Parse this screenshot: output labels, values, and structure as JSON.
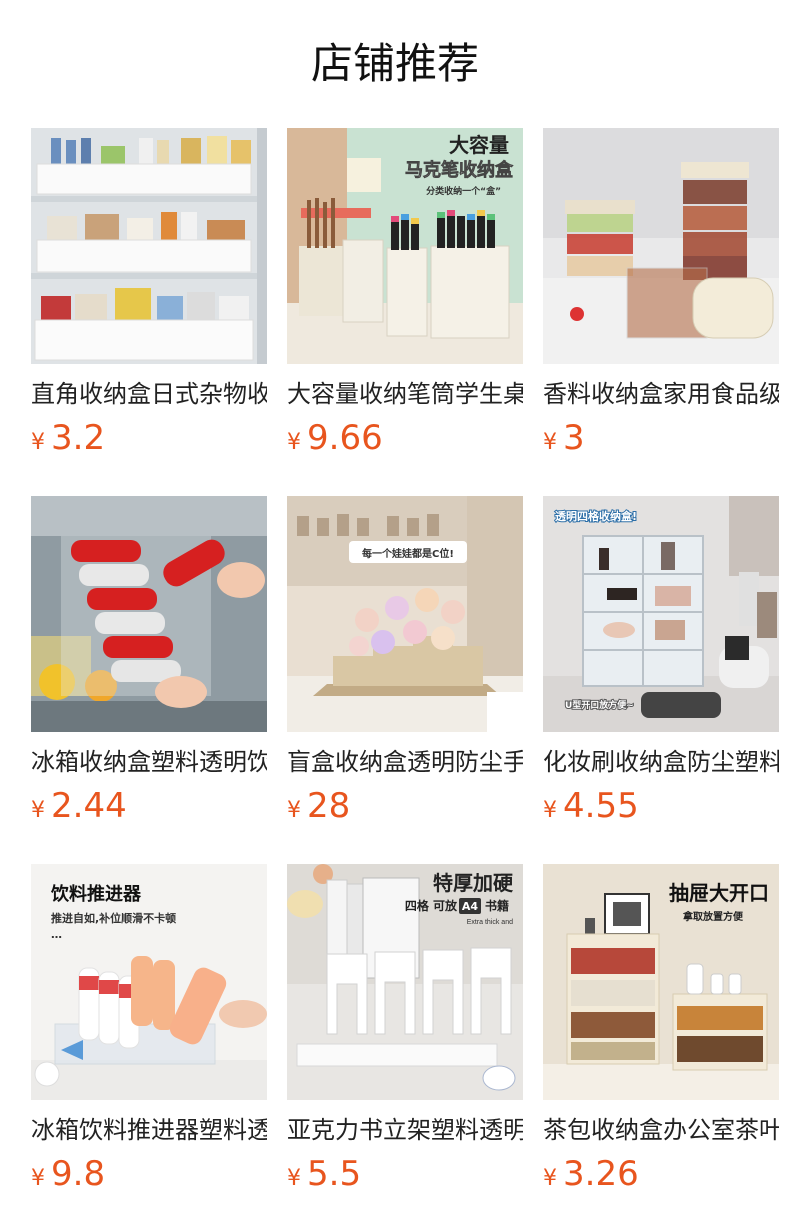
{
  "page": {
    "title": "店铺推荐"
  },
  "currency": "¥",
  "products": [
    {
      "name": "直角收纳盒日式杂物收纳",
      "price": "3.2",
      "image_text": []
    },
    {
      "name": "大容量收纳笔筒学生桌面",
      "price": "9.66",
      "image_text": [
        "大容量",
        "马克笔收纳盒",
        "分类收纳一个“盒”"
      ]
    },
    {
      "name": "香料收纳盒家用食品级",
      "price": "3",
      "image_text": []
    },
    {
      "name": "冰箱收纳盒塑料透明饮料",
      "price": "2.44",
      "image_text": []
    },
    {
      "name": "盲盒收纳盒透明防尘手办",
      "price": "28",
      "image_text": [
        "每一个娃娃都是C位!"
      ]
    },
    {
      "name": "化妆刷收纳盒防尘塑料",
      "price": "4.55",
      "image_text": [
        "透明四格收纳盒!",
        "U型开口放方便~"
      ]
    },
    {
      "name": "冰箱饮料推进器塑料透明",
      "price": "9.8",
      "image_text": [
        "饮料推进器",
        "推进自如,补位顺滑不卡顿",
        "…"
      ]
    },
    {
      "name": "亚克力书立架塑料透明",
      "price": "5.5",
      "image_text": [
        "特厚加硬",
        "四格 可放",
        "A4",
        "书籍",
        "Extra thick and"
      ]
    },
    {
      "name": "茶包收纳盒办公室茶叶",
      "price": "3.26",
      "image_text": [
        "抽屉大开口",
        "拿取放置方便"
      ]
    }
  ]
}
